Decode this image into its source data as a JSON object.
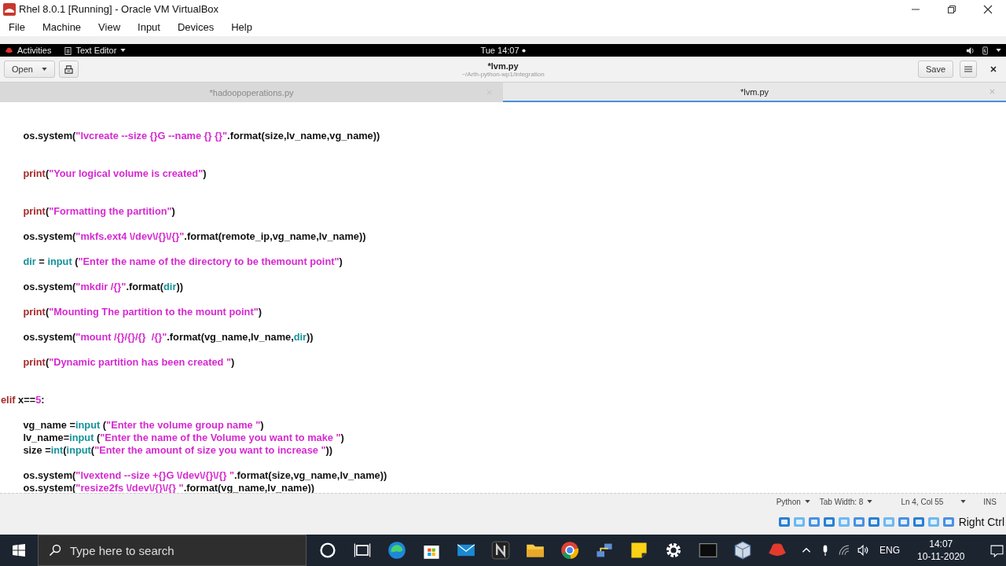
{
  "window": {
    "title": "Rhel 8.0.1 [Running] - Oracle VM VirtualBox"
  },
  "menu": [
    "File",
    "Machine",
    "View",
    "Input",
    "Devices",
    "Help"
  ],
  "top_bar": {
    "activities": "Activities",
    "app": "Text Editor",
    "clock": "Tue 14:07"
  },
  "header": {
    "open": "Open",
    "title": "*lvm.py",
    "subtitle": "~/Arth-python-wp1/integration",
    "save": "Save"
  },
  "tabs": [
    {
      "label": "*hadoopoperations.py",
      "selected": false
    },
    {
      "label": "*lvm.py",
      "selected": true
    }
  ],
  "code": [
    {
      "kind": "code",
      "tokens": [
        {
          "kind": "plain",
          "text": "        os.system("
        },
        {
          "kind": "string",
          "text": "\"lvcreate --size {}G --name {} {}\""
        },
        {
          "kind": "plain",
          "text": ".format(size,lv_name,vg_name))"
        }
      ]
    },
    {
      "kind": "blank"
    },
    {
      "kind": "blank"
    },
    {
      "kind": "code",
      "tokens": [
        {
          "kind": "keyword",
          "text": "        print"
        },
        {
          "kind": "plain",
          "text": "("
        },
        {
          "kind": "string",
          "text": "\"Your logical volume is created\""
        },
        {
          "kind": "plain",
          "text": ")"
        }
      ]
    },
    {
      "kind": "blank"
    },
    {
      "kind": "blank"
    },
    {
      "kind": "code",
      "tokens": [
        {
          "kind": "keyword",
          "text": "        print"
        },
        {
          "kind": "plain",
          "text": "("
        },
        {
          "kind": "string",
          "text": "\"Formatting the partition\""
        },
        {
          "kind": "plain",
          "text": ")"
        }
      ]
    },
    {
      "kind": "blank"
    },
    {
      "kind": "code",
      "tokens": [
        {
          "kind": "plain",
          "text": "        os.system("
        },
        {
          "kind": "string",
          "text": "\"mkfs.ext4 \\/dev\\/{}\\/{}\""
        },
        {
          "kind": "plain",
          "text": ".format(remote_ip,vg_name,lv_name))"
        }
      ]
    },
    {
      "kind": "blank"
    },
    {
      "kind": "code",
      "tokens": [
        {
          "kind": "builtin",
          "text": "        dir"
        },
        {
          "kind": "plain",
          "text": " = "
        },
        {
          "kind": "builtin",
          "text": "input"
        },
        {
          "kind": "plain",
          "text": " ("
        },
        {
          "kind": "string",
          "text": "\"Enter the name of the directory to be themount point\""
        },
        {
          "kind": "plain",
          "text": ")"
        }
      ]
    },
    {
      "kind": "blank"
    },
    {
      "kind": "code",
      "tokens": [
        {
          "kind": "plain",
          "text": "        os.system("
        },
        {
          "kind": "string",
          "text": "\"mkdir /{}\""
        },
        {
          "kind": "plain",
          "text": ".format("
        },
        {
          "kind": "builtin",
          "text": "dir"
        },
        {
          "kind": "plain",
          "text": "))"
        }
      ]
    },
    {
      "kind": "blank"
    },
    {
      "kind": "code",
      "tokens": [
        {
          "kind": "keyword",
          "text": "        print"
        },
        {
          "kind": "plain",
          "text": "("
        },
        {
          "kind": "string",
          "text": "\"Mounting The partition to the mount point\""
        },
        {
          "kind": "plain",
          "text": ")"
        }
      ]
    },
    {
      "kind": "blank"
    },
    {
      "kind": "code",
      "tokens": [
        {
          "kind": "plain",
          "text": "        os.system("
        },
        {
          "kind": "string",
          "text": "\"mount /{}/{}/{}  /{}\""
        },
        {
          "kind": "plain",
          "text": ".format(vg_name,lv_name,"
        },
        {
          "kind": "builtin",
          "text": "dir"
        },
        {
          "kind": "plain",
          "text": "))"
        }
      ]
    },
    {
      "kind": "blank"
    },
    {
      "kind": "code",
      "tokens": [
        {
          "kind": "keyword",
          "text": "        print"
        },
        {
          "kind": "plain",
          "text": "("
        },
        {
          "kind": "string",
          "text": "\"Dynamic partition has been created \""
        },
        {
          "kind": "plain",
          "text": ")"
        }
      ]
    },
    {
      "kind": "blank"
    },
    {
      "kind": "blank"
    },
    {
      "kind": "code",
      "tokens": [
        {
          "kind": "keyword",
          "text": "elif"
        },
        {
          "kind": "plain",
          "text": " x=="
        },
        {
          "kind": "number",
          "text": "5"
        },
        {
          "kind": "plain",
          "text": ":"
        }
      ]
    },
    {
      "kind": "blank"
    },
    {
      "kind": "code",
      "tokens": [
        {
          "kind": "plain",
          "text": "        vg_name ="
        },
        {
          "kind": "builtin",
          "text": "input"
        },
        {
          "kind": "plain",
          "text": " ("
        },
        {
          "kind": "string",
          "text": "\"Enter the volume group name \""
        },
        {
          "kind": "plain",
          "text": ")"
        }
      ]
    },
    {
      "kind": "code",
      "tokens": [
        {
          "kind": "plain",
          "text": "        lv_name="
        },
        {
          "kind": "builtin",
          "text": "input"
        },
        {
          "kind": "plain",
          "text": " ("
        },
        {
          "kind": "string",
          "text": "\"Enter the name of the Volume you want to make \""
        },
        {
          "kind": "plain",
          "text": ")"
        }
      ]
    },
    {
      "kind": "code",
      "tokens": [
        {
          "kind": "plain",
          "text": "        size ="
        },
        {
          "kind": "builtin",
          "text": "int"
        },
        {
          "kind": "plain",
          "text": "("
        },
        {
          "kind": "builtin",
          "text": "input"
        },
        {
          "kind": "plain",
          "text": "("
        },
        {
          "kind": "string",
          "text": "\"Enter the amount of size you want to increase \""
        },
        {
          "kind": "plain",
          "text": "))"
        }
      ]
    },
    {
      "kind": "blank"
    },
    {
      "kind": "code",
      "tokens": [
        {
          "kind": "plain",
          "text": "        os.system("
        },
        {
          "kind": "string",
          "text": "\"lvextend --size +{}G \\/dev\\/{}\\/{} \""
        },
        {
          "kind": "plain",
          "text": ".format(size,vg_name,lv_name))"
        }
      ]
    },
    {
      "kind": "code",
      "tokens": [
        {
          "kind": "plain",
          "text": "        os.system("
        },
        {
          "kind": "string",
          "text": "\"resize2fs \\/dev\\/{}\\/{} \""
        },
        {
          "kind": "plain",
          "text": ".format(vg_name,lv_name))"
        }
      ]
    }
  ],
  "status": {
    "language": "Python",
    "tab_width": "Tab Width: 8",
    "position": "Ln 4, Col 55",
    "mode": "INS"
  },
  "host_key": "Right Ctrl",
  "taskbar": {
    "search": {
      "placeholder": "Type here to search"
    },
    "language": "ENG",
    "time": "14:07",
    "date": "10-11-2020"
  }
}
